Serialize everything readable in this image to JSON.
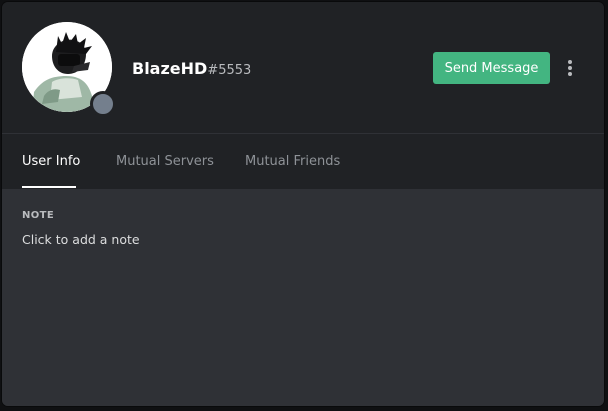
{
  "profile": {
    "username": "BlazeHD",
    "discriminator": "#5553",
    "status": "offline",
    "avatar_icon": "avatar-image"
  },
  "actions": {
    "send_message_label": "Send Message",
    "more_icon": "vertical-dots-icon"
  },
  "tabs": [
    {
      "label": "User Info",
      "active": true
    },
    {
      "label": "Mutual Servers",
      "active": false
    },
    {
      "label": "Mutual Friends",
      "active": false
    }
  ],
  "note": {
    "heading": "NOTE",
    "placeholder": "Click to add a note"
  },
  "colors": {
    "accent_green": "#43b581",
    "header_bg": "#202225",
    "body_bg": "#2f3136",
    "status_offline": "#747f8d"
  }
}
